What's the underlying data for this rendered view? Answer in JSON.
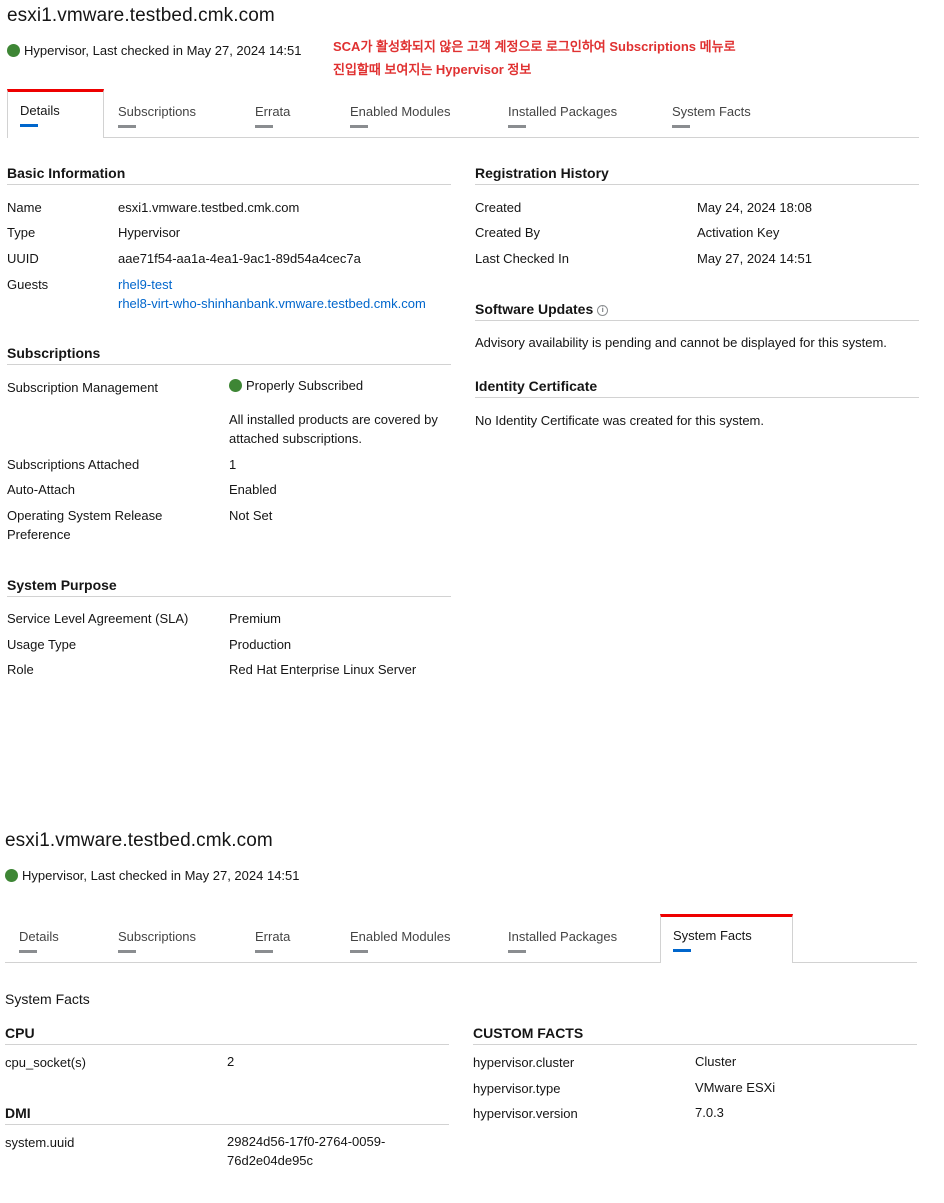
{
  "top": {
    "title": "esxi1.vmware.testbed.cmk.com",
    "status": "Hypervisor, Last checked in May 27, 2024 14:51",
    "annotation_line1": "SCA가 활성화되지 않은 고객 계정으로 로그인하여 Subscriptions 메뉴로",
    "annotation_line2": "진입할때 보여지는 Hypervisor 정보",
    "tabs": [
      "Details",
      "Subscriptions",
      "Errata",
      "Enabled Modules",
      "Installed Packages",
      "System Facts"
    ],
    "active_tab": "Details",
    "basic": {
      "heading": "Basic Information",
      "name_label": "Name",
      "name_value": "esxi1.vmware.testbed.cmk.com",
      "type_label": "Type",
      "type_value": "Hypervisor",
      "uuid_label": "UUID",
      "uuid_value": "aae71f54-aa1a-4ea1-9ac1-89d54a4cec7a",
      "guests_label": "Guests",
      "guests": [
        "rhel9-test",
        "rhel8-virt-who-shinhanbank.vmware.testbed.cmk.com"
      ]
    },
    "subscriptions": {
      "heading": "Subscriptions",
      "mgmt_label": "Subscription Management",
      "mgmt_value": "Properly Subscribed",
      "mgmt_note_1": "All installed products are covered by",
      "mgmt_note_2": "attached subscriptions.",
      "attached_label": "Subscriptions Attached",
      "attached_value": "1",
      "autoattach_label": "Auto-Attach",
      "autoattach_value": "Enabled",
      "osrel_label_1": "Operating System Release",
      "osrel_label_2": "Preference",
      "osrel_value": "Not Set"
    },
    "purpose": {
      "heading": "System Purpose",
      "sla_label": "Service Level Agreement (SLA)",
      "sla_value": "Premium",
      "usage_label": "Usage Type",
      "usage_value": "Production",
      "role_label": "Role",
      "role_value": "Red Hat Enterprise Linux Server"
    },
    "registration": {
      "heading": "Registration History",
      "created_label": "Created",
      "created_value": "May 24, 2024 18:08",
      "createdby_label": "Created By",
      "createdby_value": "Activation Key",
      "lastchecked_label": "Last Checked In",
      "lastchecked_value": "May 27, 2024 14:51"
    },
    "software": {
      "heading": "Software Updates",
      "text": "Advisory availability is pending and cannot be displayed for this system."
    },
    "identity": {
      "heading": "Identity Certificate",
      "text": "No Identity Certificate was created for this system."
    }
  },
  "bottom": {
    "title": "esxi1.vmware.testbed.cmk.com",
    "status": "Hypervisor, Last checked in May 27, 2024 14:51",
    "tabs": [
      "Details",
      "Subscriptions",
      "Errata",
      "Enabled Modules",
      "Installed Packages",
      "System Facts"
    ],
    "active_tab": "System Facts",
    "facts_title": "System Facts",
    "cpu": {
      "heading": "CPU",
      "label": "cpu_socket(s)",
      "value": "2"
    },
    "dmi": {
      "heading": "DMI",
      "label": "system.uuid",
      "value_1": "29824d56-17f0-2764-0059-",
      "value_2": "76d2e04de95c"
    },
    "custom": {
      "heading": "CUSTOM FACTS",
      "rows": [
        {
          "label": "hypervisor.cluster",
          "value": "Cluster"
        },
        {
          "label": "hypervisor.type",
          "value": "VMware ESXi"
        },
        {
          "label": "hypervisor.version",
          "value": "7.0.3"
        }
      ]
    }
  },
  "colors": {
    "status_green": "#3e8635",
    "active_tab_red": "#ee0000",
    "link_blue": "#0066cc",
    "annotation_red": "#e03131"
  },
  "icons": {
    "status": "check-circle-icon",
    "info": "info-icon"
  }
}
